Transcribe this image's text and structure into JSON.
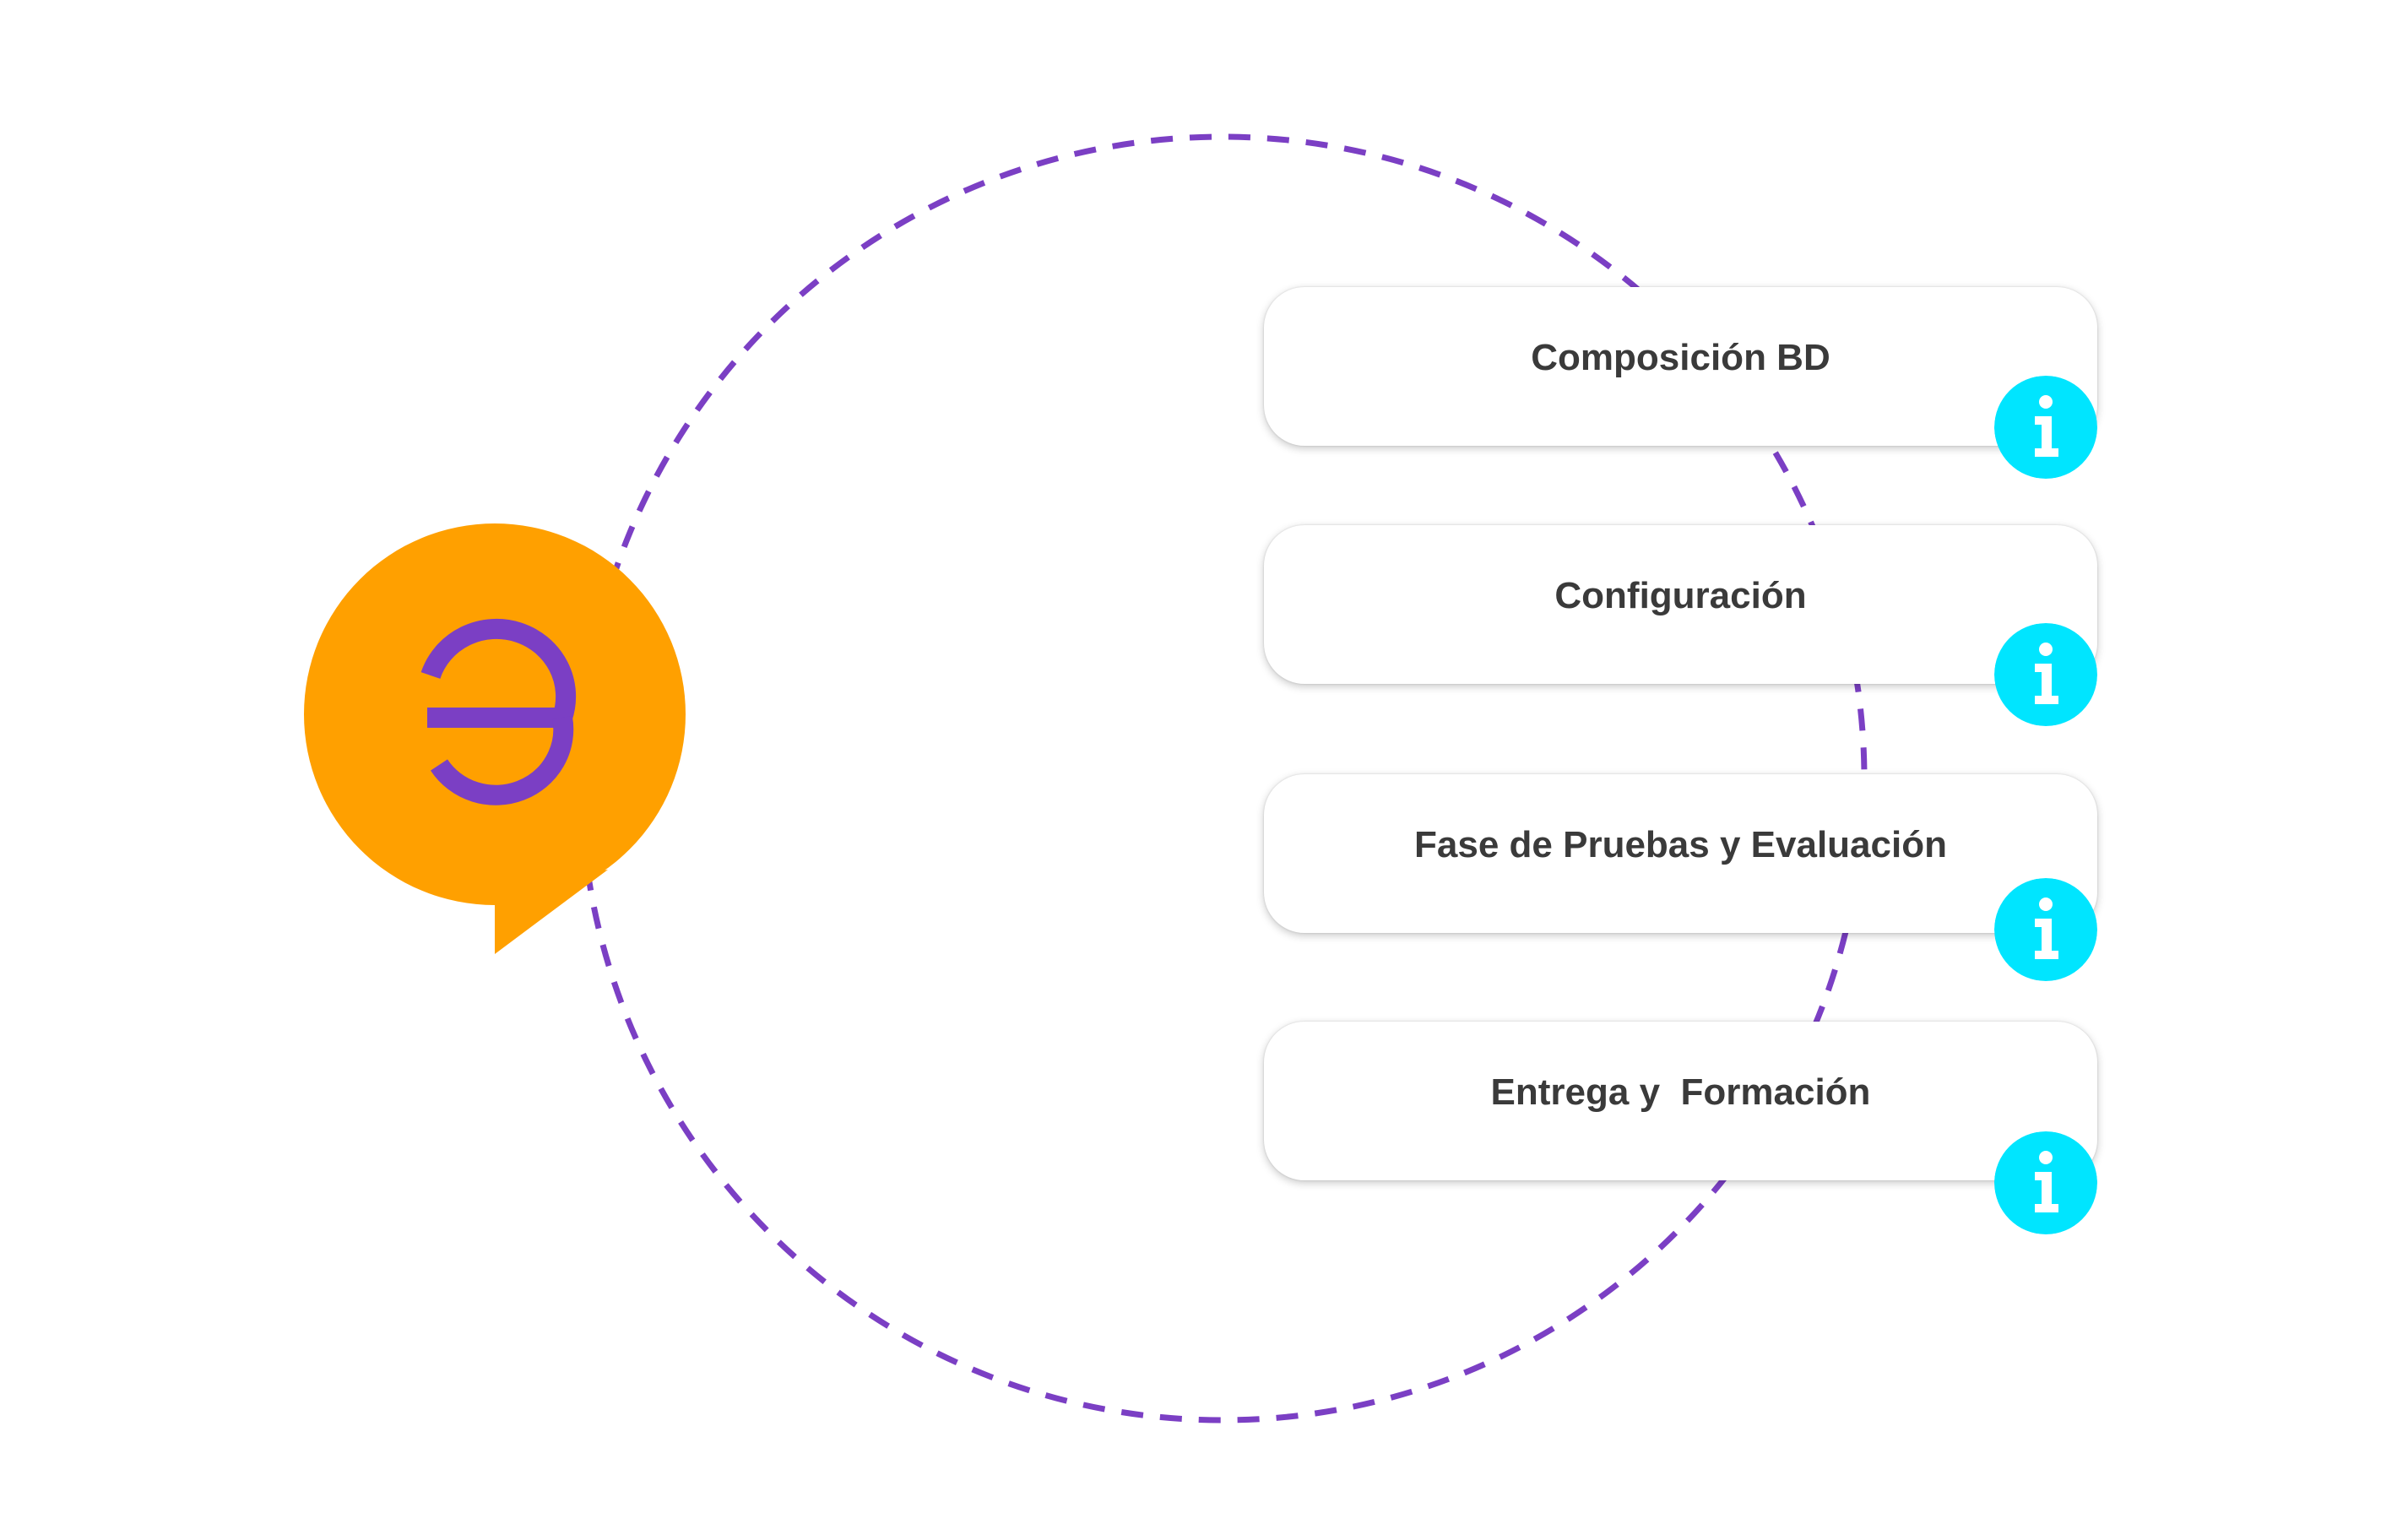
{
  "colors": {
    "orange": "#FFA000",
    "purple": "#7B3FC4",
    "cyan": "#00E5FF",
    "card_text": "#3A3A3A"
  },
  "logo": {
    "icon": "speech-bubble-logo-icon"
  },
  "steps": [
    {
      "label": "Composición BD",
      "icon": "info-icon"
    },
    {
      "label": "Configuración",
      "icon": "info-icon"
    },
    {
      "label": "Fase de Pruebas y Evaluación",
      "icon": "info-icon"
    },
    {
      "label": "Entrega y  Formación",
      "icon": "info-icon"
    }
  ]
}
